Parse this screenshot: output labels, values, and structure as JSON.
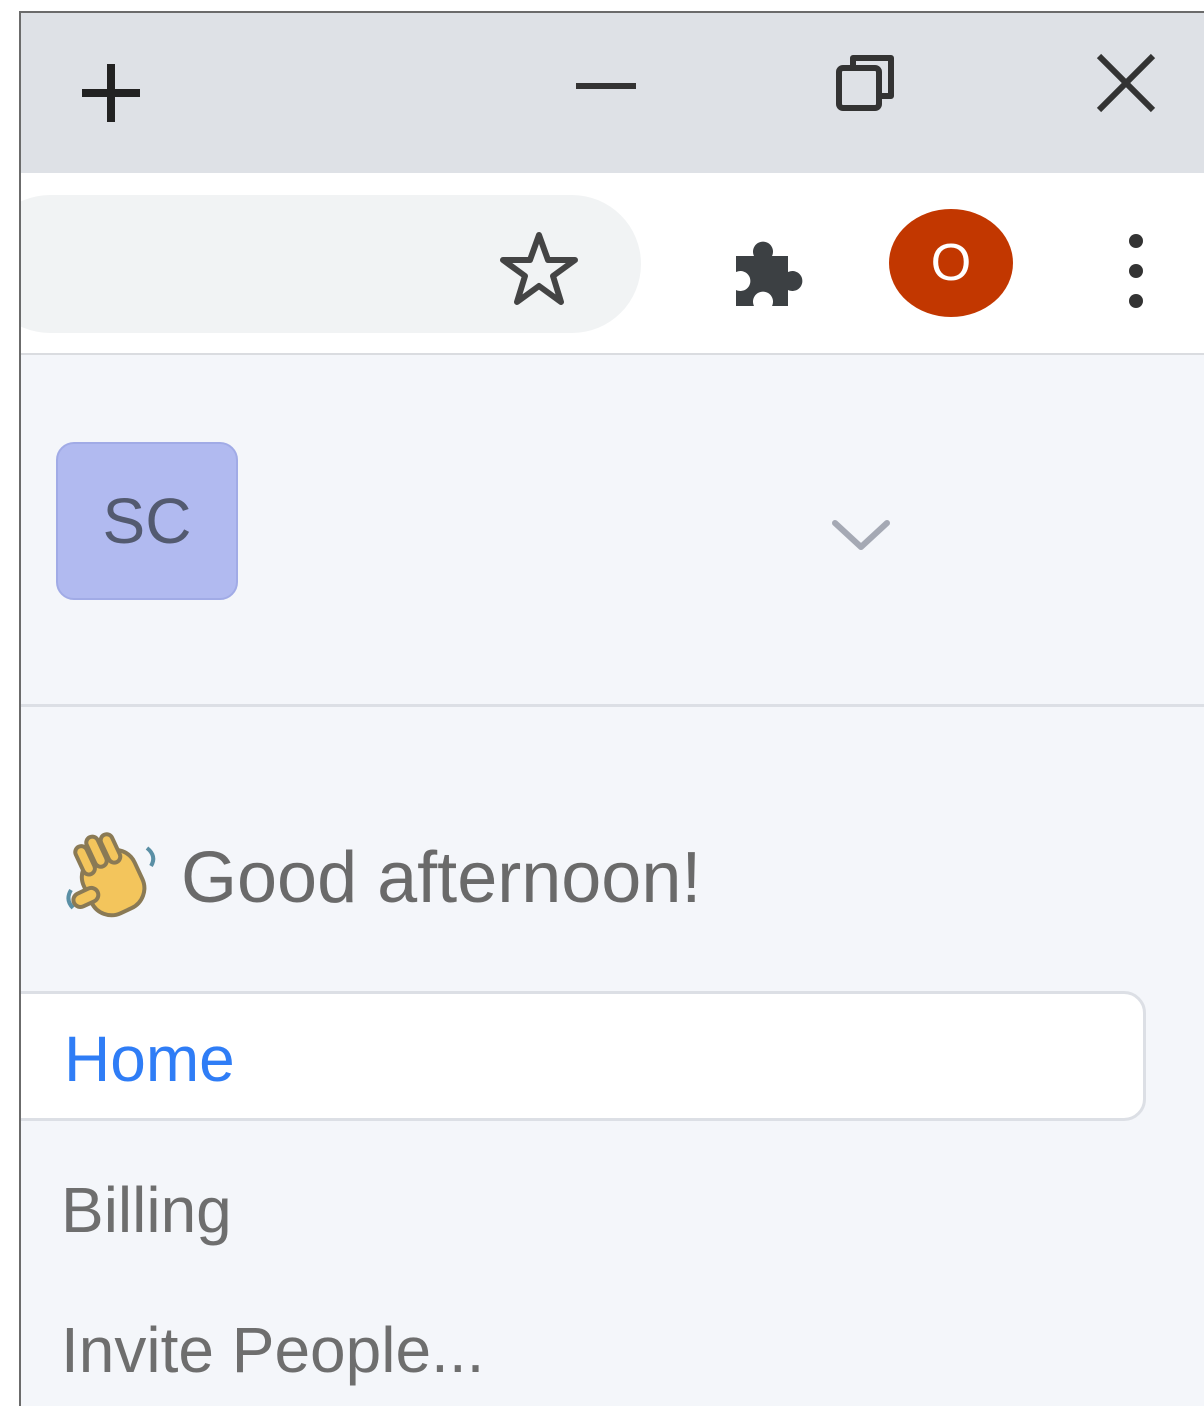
{
  "browser": {
    "new_tab_icon": "plus-icon",
    "minimize_icon": "minimize-icon",
    "restore_icon": "restore-icon",
    "close_icon": "close-icon",
    "bookmark_icon": "star-icon",
    "extensions_icon": "puzzle-icon",
    "profile_initial": "O",
    "profile_color": "#c23700",
    "menu_icon": "three-dots-icon"
  },
  "workspace": {
    "avatar_initials": "SC",
    "avatar_color": "#b1baf0",
    "dropdown_icon": "chevron-down-icon"
  },
  "greeting": {
    "emoji_icon": "waving-hand-icon",
    "text": "Good afternoon!"
  },
  "nav": {
    "items": [
      {
        "label": "Home",
        "active": true
      },
      {
        "label": "Billing",
        "active": false
      },
      {
        "label": "Invite People..."
      }
    ]
  }
}
